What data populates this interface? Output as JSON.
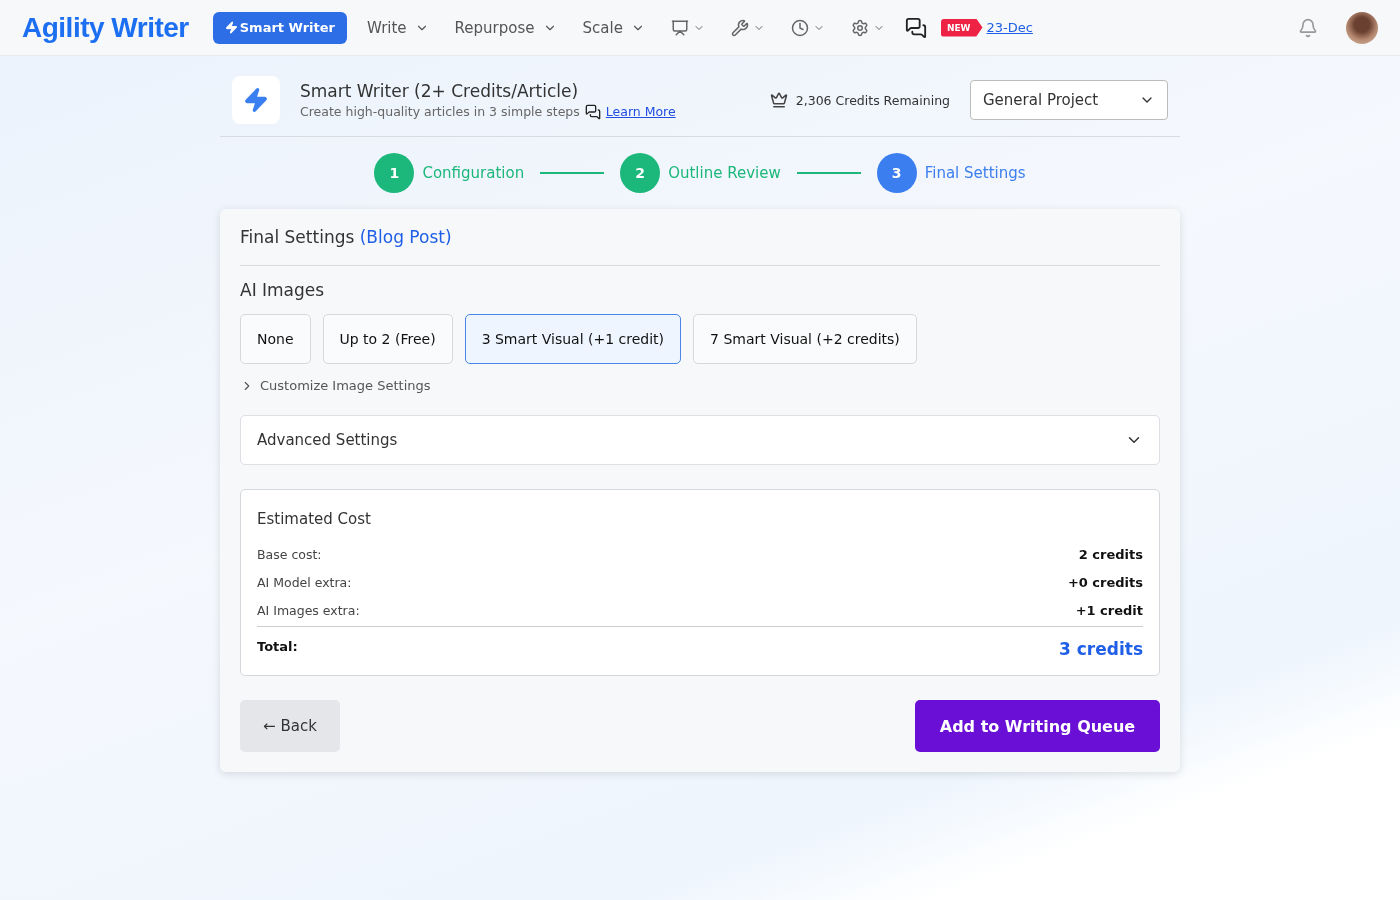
{
  "brand": {
    "logo": "Agility Writer"
  },
  "nav": {
    "primary": "Smart Writer",
    "menus": [
      {
        "label": "Write"
      },
      {
        "label": "Repurpose"
      },
      {
        "label": "Scale"
      }
    ],
    "icon_menus": [
      {
        "kind": "chart"
      },
      {
        "kind": "tools"
      },
      {
        "kind": "clock"
      },
      {
        "kind": "gear"
      }
    ],
    "badge": "NEW",
    "news_link": "23-Dec"
  },
  "header": {
    "title": "Smart Writer (2+ Credits/Article)",
    "subtitle": "Create high-quality articles in 3 simple steps",
    "learn_more": "Learn More",
    "credits": "2,306 Credits Remaining",
    "project": "General Project"
  },
  "steps": [
    {
      "number": "1",
      "label": "Configuration",
      "selected": false
    },
    {
      "number": "2",
      "label": "Outline Review",
      "selected": false
    },
    {
      "number": "3",
      "label": "Final Settings",
      "selected": true
    }
  ],
  "card": {
    "title": "Final Settings",
    "title_type": "(Blog Post)",
    "images_heading": "AI Images",
    "image_options": [
      {
        "label": "None",
        "selected": false
      },
      {
        "label": "Up to 2 (Free)",
        "selected": false
      },
      {
        "label": "3 Smart Visual (+1 credit)",
        "selected": true
      },
      {
        "label": "7 Smart Visual (+2 credits)",
        "selected": false
      }
    ],
    "customize": {
      "label": "Customize Image Settings",
      "expanded": false
    },
    "advanced": {
      "label": "Advanced Settings",
      "expanded": false
    },
    "cost": {
      "title": "Estimated Cost",
      "rows": [
        {
          "label": "Base cost:",
          "value": "2 credits"
        },
        {
          "label": "AI Model extra:",
          "value": "+0 credits"
        },
        {
          "label": "AI Images extra:",
          "value": "+1 credit"
        }
      ],
      "total_label": "Total:",
      "total_value": "3 credits"
    },
    "back": "← Back",
    "submit": "Add to Writing Queue"
  }
}
